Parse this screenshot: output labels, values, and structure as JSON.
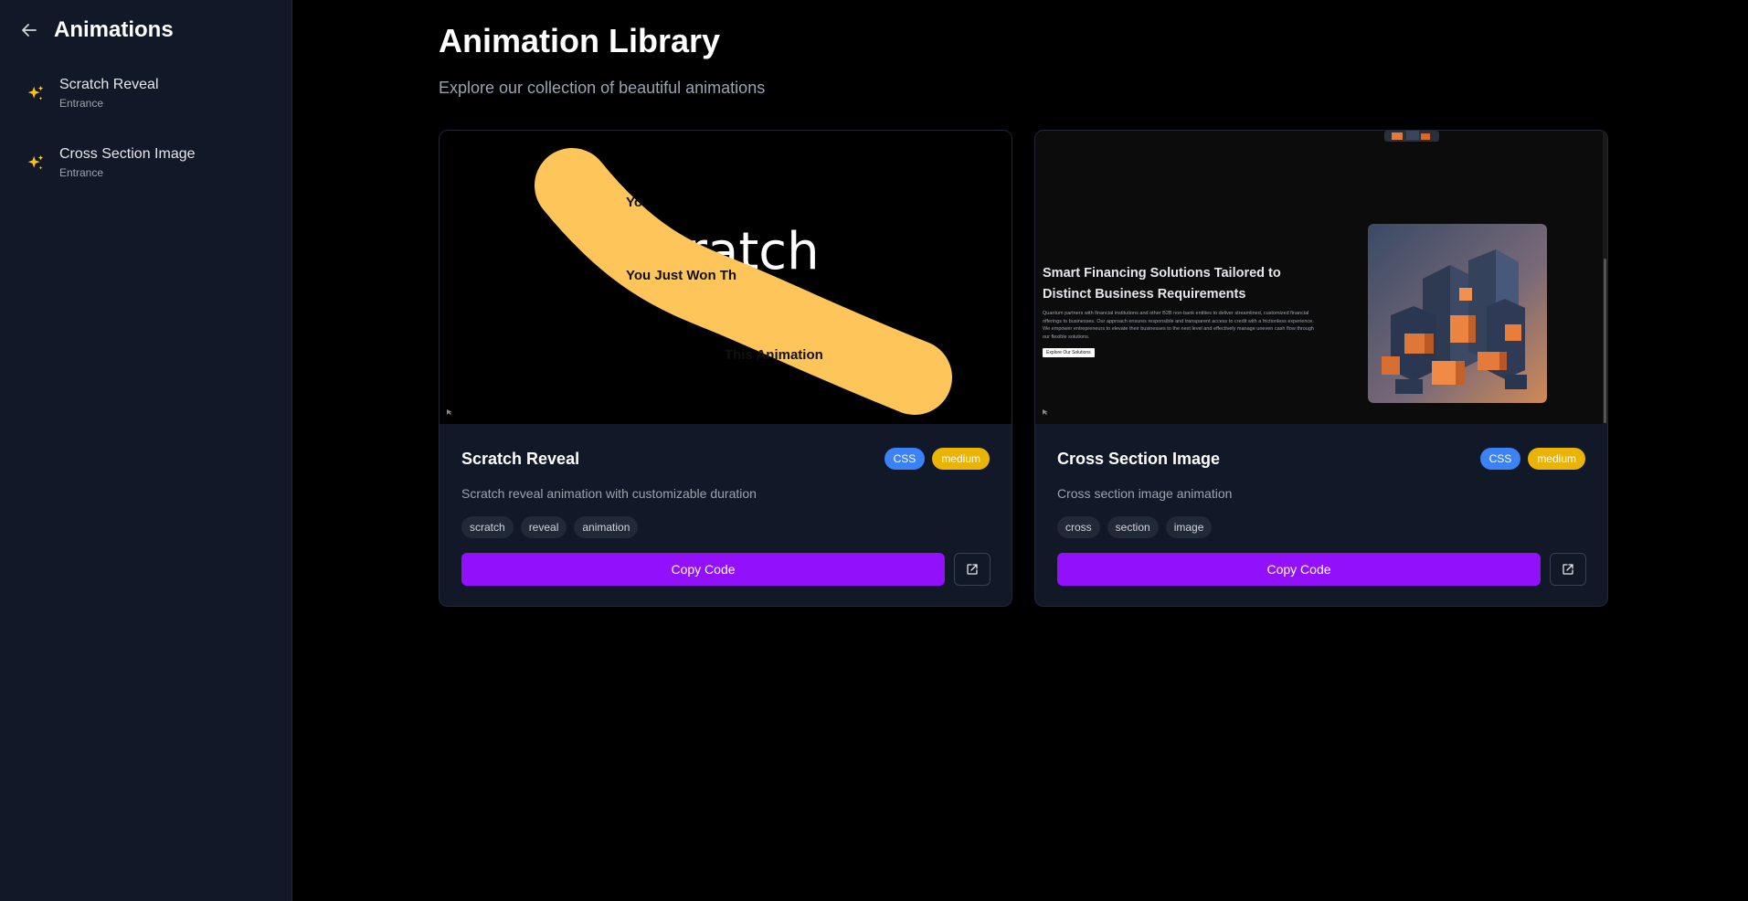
{
  "sidebar": {
    "title": "Animations",
    "items": [
      {
        "name": "Scratch Reveal",
        "category": "Entrance"
      },
      {
        "name": "Cross Section Image",
        "category": "Entrance"
      }
    ]
  },
  "main": {
    "title": "Animation Library",
    "subtitle": "Explore our collection of beautiful animations"
  },
  "cards": [
    {
      "title": "Scratch Reveal",
      "badges": [
        "CSS",
        "medium"
      ],
      "description": "Scratch reveal animation with customizable duration",
      "tags": [
        "scratch",
        "reveal",
        "animation"
      ],
      "copy_label": "Copy Code",
      "preview": {
        "big_text": "ratch",
        "lines": [
          "Yo",
          "You Just Won Th",
          "This Animation"
        ]
      }
    },
    {
      "title": "Cross Section Image",
      "badges": [
        "CSS",
        "medium"
      ],
      "description": "Cross section image animation",
      "tags": [
        "cross",
        "section",
        "image"
      ],
      "copy_label": "Copy Code",
      "preview": {
        "headline": "Smart Financing Solutions Tailored to Distinct Business Requirements",
        "paragraph": "Quantum partners with financial institutions and other B2B non-bank entities to deliver streamlined, customized financial offerings to businesses. Our approach ensures responsible and transparent access to credit with a frictionless experience. We empower entrepreneurs to elevate their businesses to the next level and effectively manage uneven cash flow through our flexible solutions.",
        "button": "Explore Our Solutions"
      }
    }
  ],
  "colors": {
    "accent": "#9210fb",
    "badge_css": "#3b82f6",
    "badge_medium": "#eab308",
    "scratch_yellow": "#fdc55a"
  }
}
